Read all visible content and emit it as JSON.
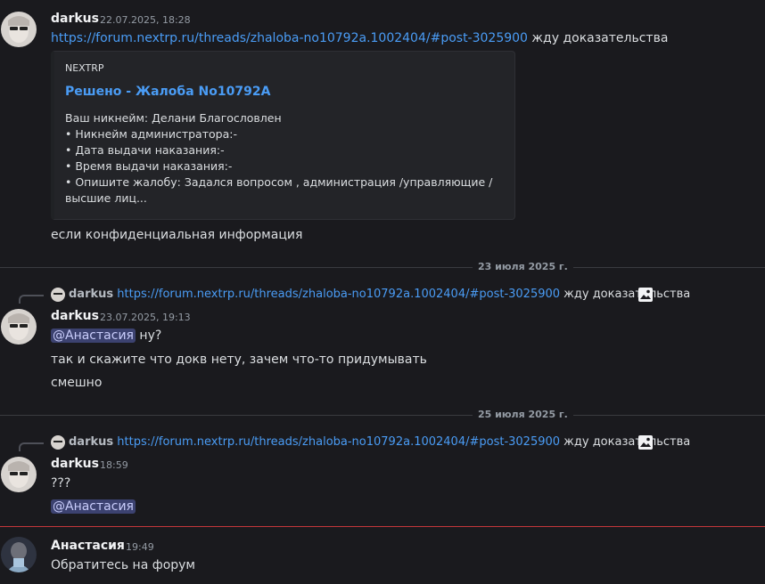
{
  "messages": [
    {
      "author": "darkus",
      "timestamp": "22.07.2025, 18:28",
      "link": "https://forum.nextrp.ru/threads/zhaloba-no10792a.1002404/#post-3025900",
      "link_suffix": " жду доказательства",
      "embed": {
        "provider": "NEXTRP",
        "title": "Решено - Жалоба No10792A",
        "lines": [
          "Ваш никнейм: Делани Благословлен",
          "• Никнейм администратора:-",
          "• Дата выдачи наказания:-",
          "• Время выдачи наказания:-",
          "• Опишите жалобу: Задался вопросом , администрация /управляющие /",
          "высшие лиц..."
        ]
      },
      "followup": "если  конфиденциальная информация"
    },
    {
      "reply": {
        "author": "darkus",
        "link": "https://forum.nextrp.ru/threads/zhaloba-no10792a.1002404/#post-3025900",
        "suffix": " жду доказательства",
        "icon": "image-icon"
      },
      "author": "darkus",
      "timestamp": "23.07.2025, 19:13",
      "mention": "@Анастасия",
      "mention_suffix": " ну?",
      "lines": [
        "так и скажите что докв нету, зачем что-то придумывать",
        "смешно"
      ]
    },
    {
      "reply": {
        "author": "darkus",
        "link": "https://forum.nextrp.ru/threads/zhaloba-no10792a.1002404/#post-3025900",
        "suffix": " жду доказательства",
        "icon": "image-icon"
      },
      "author": "darkus",
      "timestamp": "18:59",
      "line": "???",
      "mention": "@Анастасия"
    },
    {
      "author": "Анастасия",
      "timestamp": "19:49",
      "line": "Обратитесь на форум"
    }
  ],
  "dividers": [
    "23 июля 2025 г.",
    "25 июля 2025 г."
  ],
  "colors": {
    "background": "#1a1a1e",
    "link": "#4a9cf5",
    "mention_bg": "#3c4270",
    "new_messages_line": "#c4363a"
  }
}
